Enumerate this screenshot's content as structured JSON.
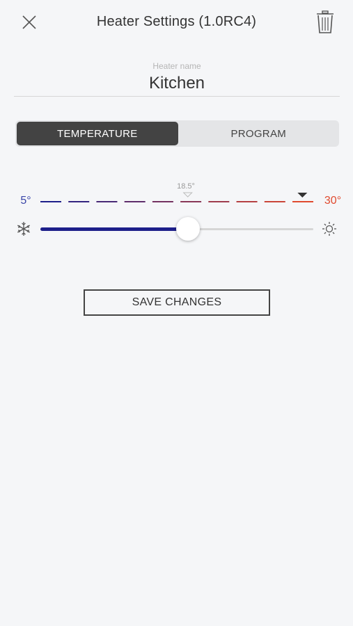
{
  "header": {
    "title": "Heater Settings (1.0RC4)",
    "close_icon": "close-icon",
    "trash_icon": "trash-icon"
  },
  "heater": {
    "name_label": "Heater name",
    "name_value": "Kitchen"
  },
  "tabs": [
    {
      "label": "TEMPERATURE",
      "active": true
    },
    {
      "label": "PROGRAM",
      "active": false
    }
  ],
  "temperature": {
    "min_label": "5°",
    "max_label": "30°",
    "current_label": "18.5°",
    "min": 5,
    "max": 30,
    "current": 18.5,
    "setpoint": 18.5,
    "marker_value": 29,
    "cold_icon": "snowflake-icon",
    "hot_icon": "sun-icon"
  },
  "colors": {
    "cold": "#1d1f8a",
    "hot": "#e04a2e",
    "active_tab": "#434343"
  },
  "save_button": {
    "label": "SAVE CHANGES"
  }
}
